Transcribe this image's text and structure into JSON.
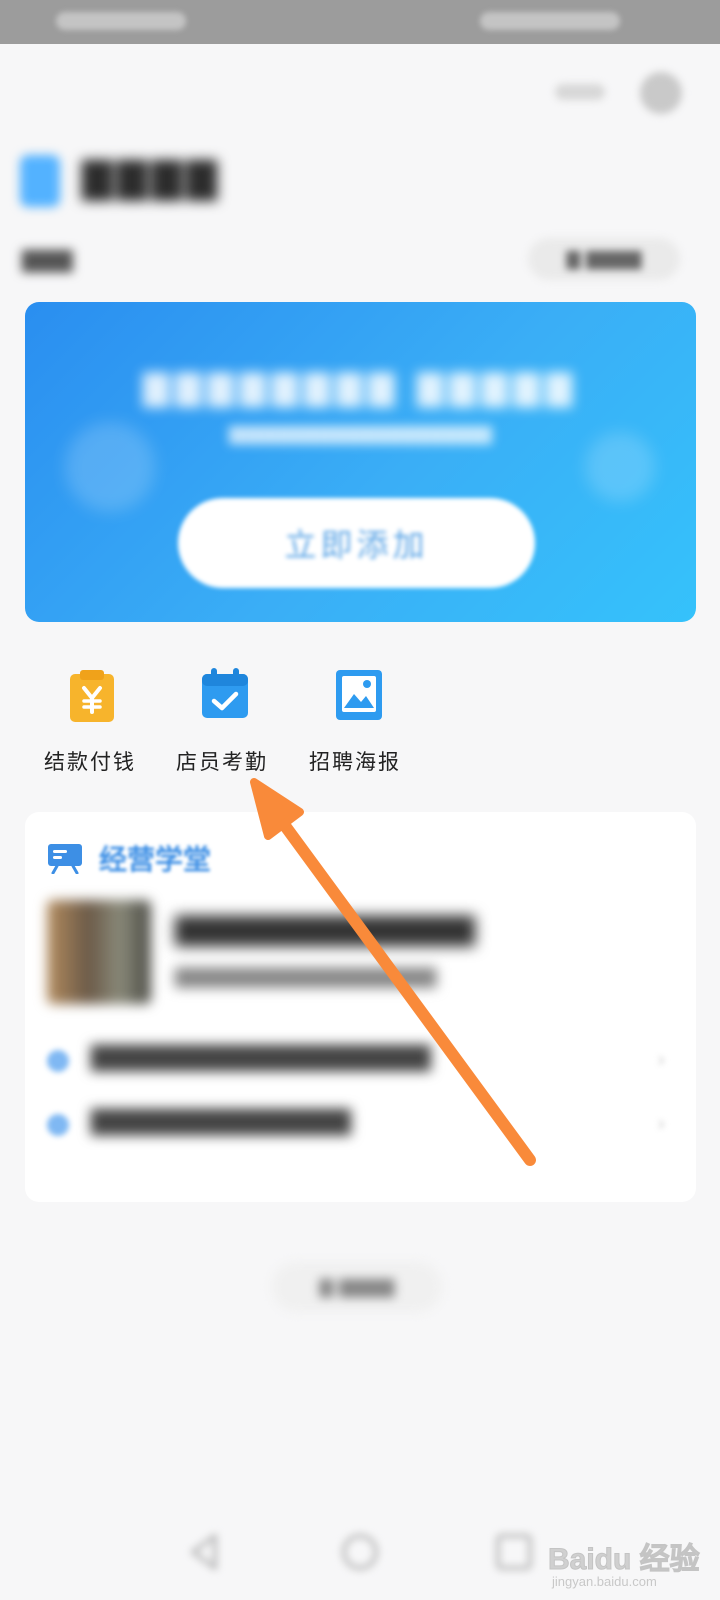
{
  "banner": {
    "add_button_label": "立即添加"
  },
  "quick_actions": [
    {
      "label": "结款付钱",
      "icon": "yen-clipboard-icon",
      "color": "#f7b42c"
    },
    {
      "label": "店员考勤",
      "icon": "calendar-check-icon",
      "color": "#2e9bf0"
    },
    {
      "label": "招聘海报",
      "icon": "poster-image-icon",
      "color": "#2e9bf0"
    }
  ],
  "academy": {
    "title": "经营学堂",
    "icon": "chalkboard-icon"
  },
  "watermark": {
    "brand": "Baidu 经验",
    "url": "jingyan.baidu.com"
  },
  "colors": {
    "accent_blue": "#2e9bf0",
    "banner_start": "#2a8ef0",
    "banner_end": "#35c2fb",
    "arrow_orange": "#f98a3a"
  }
}
